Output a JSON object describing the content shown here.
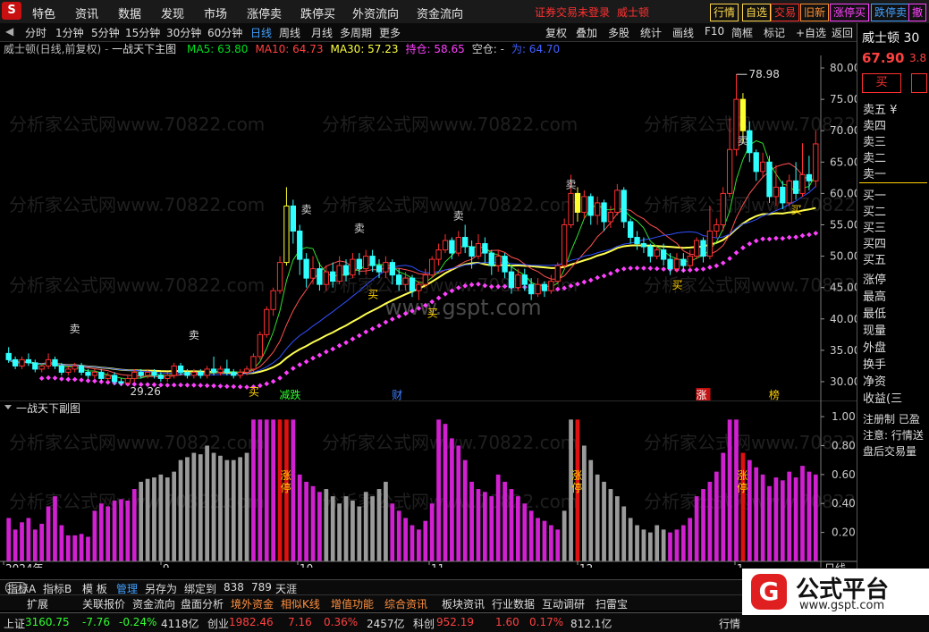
{
  "menu": {
    "logo": "S",
    "items": [
      "特色",
      "资讯",
      "数据",
      "发现",
      "市场",
      "涨停卖",
      "跌停买",
      "外资流向",
      "资金流向"
    ],
    "warning": "证券交易未登录",
    "stock_name": "威士顿",
    "quick_buttons": [
      {
        "label": "行情",
        "color": "#ffd84a"
      },
      {
        "label": "自选",
        "color": "#ffd84a"
      },
      {
        "label": "交易",
        "color": "#ff3030"
      },
      {
        "label": "旧新",
        "color": "#ff9030"
      },
      {
        "label": "涨停买",
        "color": "#ff40ff"
      },
      {
        "label": "跌停卖",
        "color": "#40a0ff"
      },
      {
        "label": "撤",
        "color": "#ff40ff"
      }
    ]
  },
  "toolbar": {
    "periods": [
      "分时",
      "1分钟",
      "5分钟",
      "15分钟",
      "30分钟",
      "60分钟",
      "日线",
      "周线",
      "月线",
      "多周期",
      "更多"
    ],
    "active_period": "日线",
    "actions": [
      "复权",
      "叠加",
      "多股",
      "统计",
      "画线",
      "F10",
      "简框",
      "标记",
      "+自选",
      "返回"
    ]
  },
  "main_chart": {
    "title": "威士顿(日线,前复权)",
    "indicator_name": "一战天下主图",
    "ma": [
      {
        "label": "MA5: 63.80",
        "color": "#00e020"
      },
      {
        "label": "MA10: 64.73",
        "color": "#ff4040"
      },
      {
        "label": "MA30: 57.23",
        "color": "#ffff40"
      },
      {
        "label": "持仓: 58.65",
        "color": "#ff40ff"
      },
      {
        "label": "空仓: -",
        "color": "#cfcfcf"
      },
      {
        "label": "为: 64.70",
        "color": "#4060ff"
      }
    ],
    "price_ticks": [
      "80.00",
      "75.00",
      "70.00",
      "65.00",
      "60.00",
      "55.00",
      "50.00",
      "45.00",
      "40.00",
      "35.00",
      "30.00"
    ],
    "high_label": "78.98",
    "low_label": "29.26",
    "watermark_url": "www.gspt.com",
    "watermark_site": "分析家公式网www.70822.com",
    "event_labels": [
      {
        "text": "减跌",
        "color": "#30ff30"
      },
      {
        "text": "财",
        "color": "#4080ff"
      },
      {
        "text": "涨",
        "color": "#ffffff",
        "bg": "#c01010"
      },
      {
        "text": "榜",
        "color": "#ffd000"
      }
    ],
    "sell_label": "卖",
    "buy_label": "买"
  },
  "sub_chart": {
    "title": "一战天下副图",
    "y_ticks": [
      "1.00",
      "0.80",
      "0.60",
      "0.40",
      "0.20"
    ],
    "limit_labels": [
      "涨停",
      "涨停",
      "涨停",
      "涨停"
    ],
    "x_labels": [
      "2024年",
      "9",
      "10",
      "11",
      "12",
      "1"
    ],
    "period_tag": "日线"
  },
  "right_panel": {
    "name": "威士顿",
    "code": "30",
    "price": "67.90",
    "change": "3.8",
    "buy_button": "买",
    "sell_levels": [
      "卖五 ¥",
      "卖四",
      "卖三",
      "卖二",
      "卖一"
    ],
    "buy_levels": [
      "买一",
      "买二",
      "买三",
      "买四",
      "买五"
    ],
    "stats": [
      "涨停",
      "最高",
      "最低",
      "现量",
      "外盘",
      "换手",
      "净资",
      "收益(三"
    ],
    "notices": [
      "注册制 已盈",
      "注意: 行情送",
      "盘后交易量"
    ]
  },
  "bottom_tabs": {
    "row1": [
      "指标A",
      "指标B",
      "模 板",
      "管理",
      "另存为",
      "绑定到",
      "838",
      "789",
      "天涯"
    ],
    "row2": [
      "扩展",
      "关联报价",
      "资金流向",
      "盘面分析",
      "境外资金",
      "相似K线",
      "增值功能",
      "综合资讯",
      "板块资讯",
      "行业数据",
      "互动调研",
      "扫雷宝"
    ]
  },
  "status_bar": {
    "sh_name": "上证",
    "sh_value": "3160.75",
    "sh_change": "-7.76",
    "sh_pct": "-0.24%",
    "sh_amount": "4118亿",
    "cy_name": "创业",
    "cy_value": "1982.46",
    "cy_change": "7.16",
    "cy_pct": "0.36%",
    "cy_amount": "2457亿",
    "kc_name": "科创",
    "kc_value": "952.19",
    "kc_change": "1.60",
    "kc_pct": "0.17%",
    "kc_amount": "812.1亿",
    "right_label": "行情"
  },
  "brand": {
    "logo_char": "G",
    "name": "公式平台",
    "url": "www.gspt.com"
  },
  "chart_data": {
    "type": "candlestick",
    "title": "威士顿(日线,前复权)",
    "ylim": [
      27,
      82
    ],
    "candles": [
      [
        34.5,
        33.5,
        35.5,
        33.0
      ],
      [
        33.5,
        32.5,
        34.0,
        32.0
      ],
      [
        32.5,
        33.5,
        34.0,
        32.0
      ],
      [
        33.5,
        33.0,
        34.5,
        32.5
      ],
      [
        33.0,
        32.0,
        33.5,
        31.5
      ],
      [
        32.0,
        32.5,
        33.0,
        31.5
      ],
      [
        32.5,
        33.5,
        34.5,
        32.0
      ],
      [
        33.5,
        32.5,
        34.0,
        32.0
      ],
      [
        32.5,
        31.5,
        33.0,
        31.0
      ],
      [
        31.5,
        32.0,
        32.5,
        31.0
      ],
      [
        32.0,
        32.5,
        33.0,
        31.5
      ],
      [
        32.5,
        31.5,
        33.0,
        31.0
      ],
      [
        31.5,
        31.0,
        32.0,
        30.5
      ],
      [
        31.0,
        31.5,
        32.0,
        30.5
      ],
      [
        31.5,
        30.5,
        32.0,
        30.0
      ],
      [
        30.5,
        31.0,
        31.5,
        30.0
      ],
      [
        31.0,
        30.0,
        31.5,
        29.5
      ],
      [
        30.0,
        29.8,
        30.5,
        29.3
      ],
      [
        29.8,
        30.5,
        31.0,
        29.5
      ],
      [
        30.5,
        31.5,
        32.0,
        30.0
      ],
      [
        31.5,
        31.0,
        32.0,
        30.5
      ],
      [
        31.0,
        31.5,
        32.0,
        30.5
      ],
      [
        31.5,
        31.0,
        32.0,
        30.5
      ],
      [
        31.0,
        30.5,
        31.5,
        30.0
      ],
      [
        30.5,
        31.0,
        31.5,
        30.0
      ],
      [
        31.0,
        32.5,
        33.0,
        30.5
      ],
      [
        32.5,
        31.5,
        33.0,
        31.0
      ],
      [
        31.5,
        31.0,
        32.0,
        30.5
      ],
      [
        31.0,
        31.5,
        32.0,
        30.5
      ],
      [
        31.5,
        31.0,
        32.0,
        30.5
      ],
      [
        31.0,
        32.0,
        32.5,
        30.5
      ],
      [
        32.0,
        31.5,
        34.0,
        31.0
      ],
      [
        31.5,
        32.0,
        32.5,
        31.0
      ],
      [
        32.0,
        31.5,
        33.5,
        31.0
      ],
      [
        31.5,
        31.0,
        32.0,
        30.5
      ],
      [
        31.0,
        31.5,
        32.0,
        30.5
      ],
      [
        31.5,
        32.0,
        32.5,
        31.0
      ],
      [
        32.0,
        34.0,
        34.5,
        31.5
      ],
      [
        34.0,
        37.5,
        38.0,
        33.5
      ],
      [
        37.5,
        41.5,
        42.0,
        37.0
      ],
      [
        41.5,
        44.5,
        45.0,
        40.5
      ],
      [
        44.5,
        49.0,
        50.0,
        44.0
      ],
      [
        49.0,
        58.0,
        61.0,
        48.5
      ],
      [
        58.0,
        54.0,
        59.0,
        52.0
      ],
      [
        54.0,
        49.5,
        55.0,
        47.0
      ],
      [
        49.5,
        46.5,
        50.5,
        45.0
      ],
      [
        46.5,
        48.0,
        50.0,
        45.5
      ],
      [
        48.0,
        45.5,
        49.0,
        44.5
      ],
      [
        45.5,
        47.5,
        48.5,
        44.5
      ],
      [
        47.5,
        46.0,
        49.0,
        45.0
      ],
      [
        46.0,
        48.5,
        50.0,
        45.5
      ],
      [
        48.5,
        47.0,
        49.5,
        46.0
      ],
      [
        47.0,
        49.5,
        50.5,
        46.5
      ],
      [
        49.5,
        48.0,
        50.5,
        47.0
      ],
      [
        48.0,
        50.0,
        51.0,
        47.0
      ],
      [
        50.0,
        48.5,
        51.0,
        47.5
      ],
      [
        48.5,
        47.5,
        49.5,
        46.5
      ],
      [
        47.5,
        49.0,
        50.0,
        46.5
      ],
      [
        49.0,
        47.0,
        49.5,
        45.5
      ],
      [
        47.0,
        45.5,
        48.0,
        44.5
      ],
      [
        45.5,
        46.5,
        47.5,
        44.5
      ],
      [
        46.5,
        44.5,
        47.0,
        43.5
      ],
      [
        44.5,
        45.5,
        46.0,
        43.0
      ],
      [
        45.5,
        47.0,
        48.0,
        45.0
      ],
      [
        47.0,
        49.5,
        50.0,
        46.5
      ],
      [
        49.5,
        51.0,
        52.0,
        48.5
      ],
      [
        51.0,
        52.5,
        53.5,
        50.5
      ],
      [
        52.5,
        50.5,
        53.0,
        49.5
      ],
      [
        50.5,
        53.0,
        54.0,
        50.0
      ],
      [
        53.0,
        51.5,
        55.0,
        50.5
      ],
      [
        51.5,
        50.0,
        52.5,
        48.0
      ],
      [
        50.0,
        52.0,
        53.5,
        49.5
      ],
      [
        52.0,
        50.5,
        53.0,
        49.0
      ],
      [
        50.5,
        48.5,
        51.0,
        47.0
      ],
      [
        48.5,
        50.0,
        51.0,
        47.5
      ],
      [
        50.0,
        47.5,
        50.5,
        46.5
      ],
      [
        47.5,
        45.0,
        48.5,
        44.0
      ],
      [
        45.0,
        47.0,
        48.0,
        44.5
      ],
      [
        47.0,
        45.5,
        48.0,
        44.5
      ],
      [
        45.5,
        44.0,
        46.5,
        43.0
      ],
      [
        44.0,
        45.5,
        46.5,
        43.5
      ],
      [
        45.5,
        44.5,
        46.0,
        43.5
      ],
      [
        44.5,
        46.0,
        47.0,
        44.0
      ],
      [
        46.0,
        48.5,
        49.0,
        45.5
      ],
      [
        48.5,
        55.0,
        56.0,
        48.0
      ],
      [
        55.0,
        60.0,
        63.0,
        54.5
      ],
      [
        60.0,
        57.0,
        61.0,
        55.5
      ],
      [
        57.0,
        59.5,
        60.5,
        56.0
      ],
      [
        59.5,
        56.5,
        60.0,
        55.0
      ],
      [
        56.5,
        58.5,
        59.5,
        55.0
      ],
      [
        58.5,
        55.5,
        59.0,
        54.0
      ],
      [
        55.5,
        57.0,
        58.0,
        54.5
      ],
      [
        57.0,
        60.5,
        61.5,
        56.5
      ],
      [
        60.5,
        55.5,
        61.0,
        54.5
      ],
      [
        55.5,
        53.0,
        56.0,
        52.0
      ],
      [
        53.0,
        52.0,
        54.0,
        51.0
      ],
      [
        52.0,
        51.5,
        53.0,
        50.5
      ],
      [
        51.5,
        50.0,
        52.0,
        49.0
      ],
      [
        50.0,
        51.0,
        51.5,
        49.5
      ],
      [
        51.0,
        49.5,
        52.0,
        48.5
      ],
      [
        49.5,
        48.0,
        50.5,
        47.0
      ],
      [
        48.0,
        49.5,
        50.5,
        47.5
      ],
      [
        49.5,
        48.5,
        50.5,
        47.5
      ],
      [
        48.5,
        50.0,
        51.0,
        48.0
      ],
      [
        50.0,
        52.5,
        53.0,
        49.5
      ],
      [
        52.5,
        50.0,
        53.0,
        49.0
      ],
      [
        50.0,
        54.0,
        58.0,
        49.5
      ],
      [
        54.0,
        55.0,
        56.0,
        53.0
      ],
      [
        55.0,
        60.0,
        61.0,
        54.0
      ],
      [
        60.0,
        67.0,
        72.0,
        59.5
      ],
      [
        67.0,
        75.0,
        78.98,
        66.0
      ],
      [
        75.0,
        70.0,
        76.0,
        68.0
      ],
      [
        70.0,
        66.5,
        71.5,
        65.0
      ],
      [
        66.5,
        63.5,
        67.0,
        62.0
      ],
      [
        63.5,
        65.0,
        66.5,
        62.5
      ],
      [
        65.0,
        59.5,
        66.0,
        58.5
      ],
      [
        59.5,
        61.0,
        64.5,
        58.0
      ],
      [
        61.0,
        58.5,
        62.0,
        57.5
      ],
      [
        58.5,
        62.0,
        63.0,
        58.0
      ],
      [
        62.0,
        60.0,
        65.0,
        59.0
      ],
      [
        60.0,
        63.0,
        68.0,
        59.5
      ],
      [
        63.0,
        62.0,
        66.0,
        60.5
      ],
      [
        62.0,
        67.9,
        70.0,
        61.0
      ]
    ],
    "limit_up_days": [
      42,
      86,
      111
    ],
    "volume": [
      0.3,
      0.22,
      0.27,
      0.3,
      0.22,
      0.26,
      0.38,
      0.45,
      0.25,
      0.18,
      0.18,
      0.19,
      0.17,
      0.35,
      0.4,
      0.38,
      0.42,
      0.43,
      0.42,
      0.5,
      0.55,
      0.57,
      0.58,
      0.6,
      0.58,
      0.62,
      0.7,
      0.72,
      0.75,
      0.74,
      0.8,
      0.75,
      0.73,
      0.7,
      0.7,
      0.72,
      0.75,
      0.98,
      0.98,
      0.98,
      0.98,
      0.98,
      0.98,
      0.98,
      0.6,
      0.55,
      0.52,
      0.48,
      0.5,
      0.45,
      0.4,
      0.45,
      0.42,
      0.38,
      0.48,
      0.45,
      0.5,
      0.55,
      0.4,
      0.35,
      0.3,
      0.25,
      0.22,
      0.28,
      0.4,
      0.98,
      0.95,
      0.85,
      0.8,
      0.7,
      0.55,
      0.5,
      0.48,
      0.45,
      0.6,
      0.55,
      0.5,
      0.45,
      0.4,
      0.35,
      0.3,
      0.28,
      0.25,
      0.22,
      0.35,
      0.98,
      0.98,
      0.8,
      0.7,
      0.6,
      0.55,
      0.5,
      0.45,
      0.38,
      0.3,
      0.25,
      0.22,
      0.2,
      0.25,
      0.22,
      0.2,
      0.22,
      0.25,
      0.3,
      0.45,
      0.5,
      0.55,
      0.62,
      0.75,
      0.98,
      0.98,
      0.75,
      0.7,
      0.65,
      0.6,
      0.52,
      0.58,
      0.56,
      0.62,
      0.58,
      0.66,
      0.62,
      0.6
    ],
    "volume_ylim": [
      0,
      1.05
    ]
  }
}
